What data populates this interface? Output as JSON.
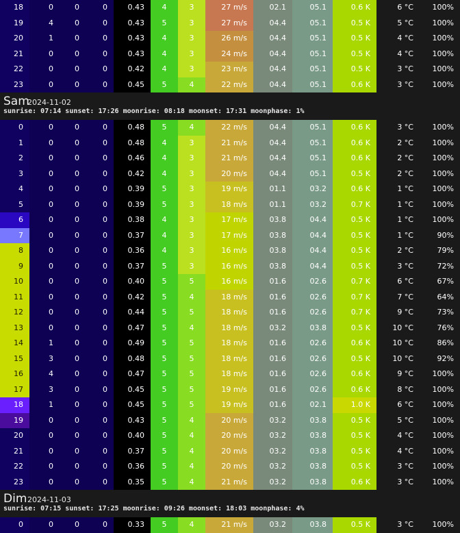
{
  "colors": {
    "hour_day": "#c8dc00",
    "hour_night": "#100060",
    "hour_dawn": "#7878ff",
    "hour_dusk": "#6a1fff",
    "night_purple": "#4a0c9c",
    "night_indigo": "#2a07c0",
    "precip_bg": "#0e0052",
    "uv_bg": "#000000",
    "wind_green": "#44cc22",
    "gust_lime": "#88dd22",
    "gust_yellow": "#bbe020",
    "speed_orange": "#c87850",
    "speed_amber": "#c49040",
    "speed_gold": "#c8a838",
    "speed_yellow": "#c8c020",
    "speed_lime": "#c0d400",
    "fog_grey": "#7a8a7a",
    "cloud_grey": "#7a9a88",
    "temp_lime": "#a8d800",
    "temp_yellow": "#c8d800",
    "temp_bg": "#000000"
  },
  "days": [
    {
      "name": "",
      "date": "",
      "info": "",
      "rows": [
        [
          "18",
          "0",
          "0",
          "0",
          "0.43",
          "4",
          "3",
          "27 m/s",
          "02.1",
          "05.1",
          "0.6 K",
          "6 °C",
          "100%",
          "hour_night"
        ],
        [
          "19",
          "4",
          "0",
          "0",
          "0.43",
          "5",
          "3",
          "27 m/s",
          "04.4",
          "05.1",
          "0.5 K",
          "5 °C",
          "100%",
          "hour_night"
        ],
        [
          "20",
          "1",
          "0",
          "0",
          "0.43",
          "4",
          "3",
          "26 m/s",
          "04.4",
          "05.1",
          "0.5 K",
          "4 °C",
          "100%",
          "hour_night"
        ],
        [
          "21",
          "0",
          "0",
          "0",
          "0.43",
          "4",
          "3",
          "24 m/s",
          "04.4",
          "05.1",
          "0.5 K",
          "4 °C",
          "100%",
          "hour_night"
        ],
        [
          "22",
          "0",
          "0",
          "0",
          "0.42",
          "4",
          "3",
          "23 m/s",
          "04.4",
          "05.1",
          "0.5 K",
          "3 °C",
          "100%",
          "hour_night"
        ],
        [
          "23",
          "0",
          "0",
          "0",
          "0.45",
          "5",
          "4",
          "22 m/s",
          "04.4",
          "05.1",
          "0.6 K",
          "3 °C",
          "100%",
          "hour_night"
        ]
      ]
    },
    {
      "name": "Sam",
      "date": "2024-11-02",
      "info": "sunrise: 07:14 sunset: 17:26 moonrise: 08:18 moonset: 17:31 moonphase: 1%",
      "rows": [
        [
          "0",
          "0",
          "0",
          "0",
          "0.48",
          "5",
          "4",
          "22 m/s",
          "04.4",
          "05.1",
          "0.6 K",
          "3 °C",
          "100%",
          "hour_night"
        ],
        [
          "1",
          "0",
          "0",
          "0",
          "0.48",
          "4",
          "3",
          "21 m/s",
          "04.4",
          "05.1",
          "0.6 K",
          "2 °C",
          "100%",
          "hour_night"
        ],
        [
          "2",
          "0",
          "0",
          "0",
          "0.46",
          "4",
          "3",
          "21 m/s",
          "04.4",
          "05.1",
          "0.6 K",
          "2 °C",
          "100%",
          "hour_night"
        ],
        [
          "3",
          "0",
          "0",
          "0",
          "0.42",
          "4",
          "3",
          "20 m/s",
          "04.4",
          "05.1",
          "0.5 K",
          "2 °C",
          "100%",
          "hour_night"
        ],
        [
          "4",
          "0",
          "0",
          "0",
          "0.39",
          "5",
          "3",
          "19 m/s",
          "01.1",
          "03.2",
          "0.6 K",
          "1 °C",
          "100%",
          "hour_night"
        ],
        [
          "5",
          "0",
          "0",
          "0",
          "0.39",
          "5",
          "3",
          "18 m/s",
          "01.1",
          "03.2",
          "0.7 K",
          "1 °C",
          "100%",
          "hour_night"
        ],
        [
          "6",
          "0",
          "0",
          "0",
          "0.38",
          "4",
          "3",
          "17 m/s",
          "03.8",
          "04.4",
          "0.5 K",
          "1 °C",
          "100%",
          "night_indigo"
        ],
        [
          "7",
          "0",
          "0",
          "0",
          "0.37",
          "4",
          "3",
          "17 m/s",
          "03.8",
          "04.4",
          "0.5 K",
          "1 °C",
          "90%",
          "hour_dawn"
        ],
        [
          "8",
          "0",
          "0",
          "0",
          "0.36",
          "4",
          "3",
          "16 m/s",
          "03.8",
          "04.4",
          "0.5 K",
          "2 °C",
          "79%",
          "hour_day"
        ],
        [
          "9",
          "0",
          "0",
          "0",
          "0.37",
          "5",
          "3",
          "16 m/s",
          "03.8",
          "04.4",
          "0.5 K",
          "3 °C",
          "72%",
          "hour_day"
        ],
        [
          "10",
          "0",
          "0",
          "0",
          "0.40",
          "5",
          "5",
          "16 m/s",
          "01.6",
          "02.6",
          "0.7 K",
          "6 °C",
          "67%",
          "hour_day"
        ],
        [
          "11",
          "0",
          "0",
          "0",
          "0.42",
          "5",
          "4",
          "18 m/s",
          "01.6",
          "02.6",
          "0.7 K",
          "7 °C",
          "64%",
          "hour_day"
        ],
        [
          "12",
          "0",
          "0",
          "0",
          "0.44",
          "5",
          "5",
          "18 m/s",
          "01.6",
          "02.6",
          "0.7 K",
          "9 °C",
          "73%",
          "hour_day"
        ],
        [
          "13",
          "0",
          "0",
          "0",
          "0.47",
          "5",
          "4",
          "18 m/s",
          "03.2",
          "03.8",
          "0.5 K",
          "10 °C",
          "76%",
          "hour_day"
        ],
        [
          "14",
          "1",
          "0",
          "0",
          "0.49",
          "5",
          "5",
          "18 m/s",
          "01.6",
          "02.6",
          "0.6 K",
          "10 °C",
          "86%",
          "hour_day"
        ],
        [
          "15",
          "3",
          "0",
          "0",
          "0.48",
          "5",
          "5",
          "18 m/s",
          "01.6",
          "02.6",
          "0.5 K",
          "10 °C",
          "92%",
          "hour_day"
        ],
        [
          "16",
          "4",
          "0",
          "0",
          "0.47",
          "5",
          "5",
          "18 m/s",
          "01.6",
          "02.6",
          "0.6 K",
          "9 °C",
          "100%",
          "hour_day"
        ],
        [
          "17",
          "3",
          "0",
          "0",
          "0.45",
          "5",
          "5",
          "19 m/s",
          "01.6",
          "02.6",
          "0.6 K",
          "8 °C",
          "100%",
          "hour_day"
        ],
        [
          "18",
          "1",
          "0",
          "0",
          "0.45",
          "5",
          "5",
          "19 m/s",
          "01.6",
          "02.1",
          "1.0 K",
          "6 °C",
          "100%",
          "hour_dusk"
        ],
        [
          "19",
          "0",
          "0",
          "0",
          "0.43",
          "5",
          "4",
          "20 m/s",
          "03.2",
          "03.8",
          "0.5 K",
          "5 °C",
          "100%",
          "night_purple"
        ],
        [
          "20",
          "0",
          "0",
          "0",
          "0.40",
          "5",
          "4",
          "20 m/s",
          "03.2",
          "03.8",
          "0.5 K",
          "4 °C",
          "100%",
          "hour_night"
        ],
        [
          "21",
          "0",
          "0",
          "0",
          "0.37",
          "5",
          "4",
          "20 m/s",
          "03.2",
          "03.8",
          "0.5 K",
          "4 °C",
          "100%",
          "hour_night"
        ],
        [
          "22",
          "0",
          "0",
          "0",
          "0.36",
          "5",
          "4",
          "20 m/s",
          "03.2",
          "03.8",
          "0.5 K",
          "3 °C",
          "100%",
          "hour_night"
        ],
        [
          "23",
          "0",
          "0",
          "0",
          "0.35",
          "5",
          "4",
          "21 m/s",
          "03.2",
          "03.8",
          "0.6 K",
          "3 °C",
          "100%",
          "hour_night"
        ]
      ]
    },
    {
      "name": "Dim",
      "date": "2024-11-03",
      "info": "sunrise: 07:15 sunset: 17:25 moonrise: 09:26 moonset: 18:03 moonphase: 4%",
      "rows": [
        [
          "0",
          "0",
          "0",
          "0",
          "0.33",
          "5",
          "4",
          "21 m/s",
          "03.2",
          "03.8",
          "0.5 K",
          "3 °C",
          "100%",
          "hour_night"
        ]
      ]
    }
  ]
}
